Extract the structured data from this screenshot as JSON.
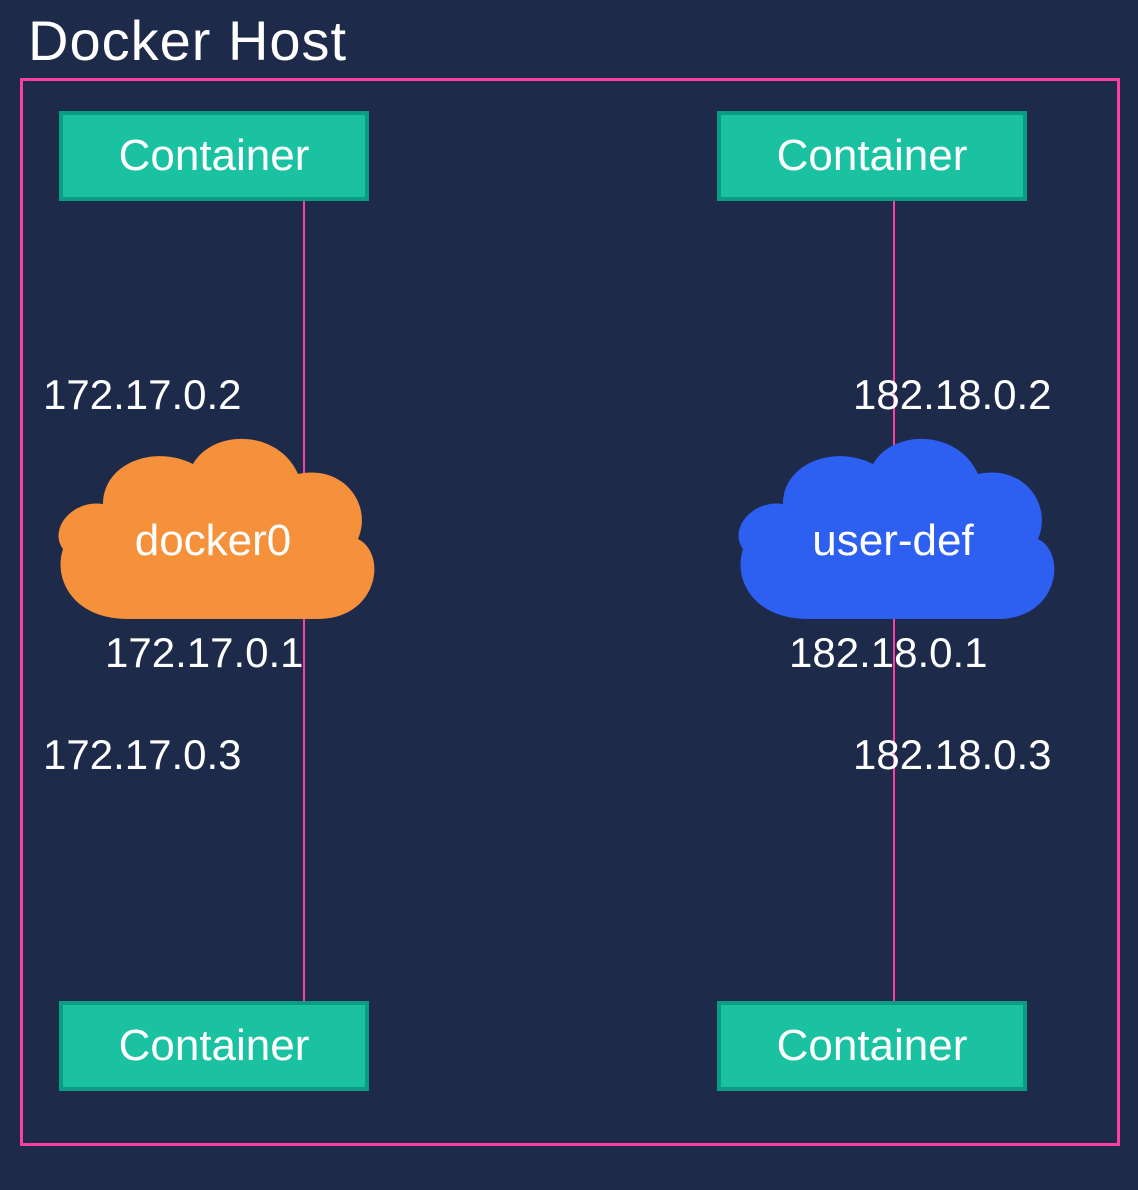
{
  "title": "Docker Host",
  "colors": {
    "background": "#1e2a4a",
    "host_border": "#ff3ea5",
    "container_fill": "#1bc2a2",
    "container_border": "#0a9d84",
    "cloud_left": "#f5913b",
    "cloud_right": "#2d5ff0"
  },
  "left": {
    "top_container_label": "Container",
    "bottom_container_label": "Container",
    "network_name": "docker0",
    "ip_top": "172.17.0.2",
    "ip_gateway": "172.17.0.1",
    "ip_bottom": "172.17.0.3"
  },
  "right": {
    "top_container_label": "Container",
    "bottom_container_label": "Container",
    "network_name": "user-def",
    "ip_top": "182.18.0.2",
    "ip_gateway": "182.18.0.1",
    "ip_bottom": "182.18.0.3"
  }
}
